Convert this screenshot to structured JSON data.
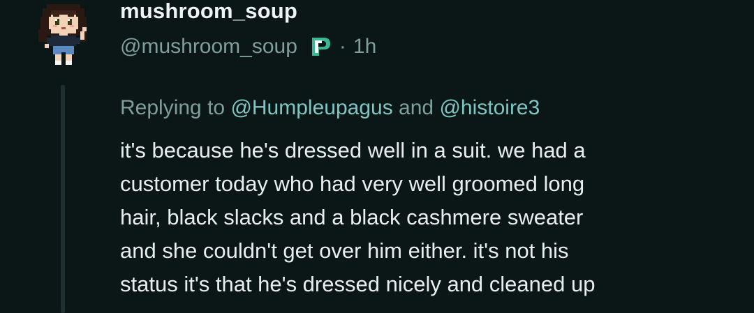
{
  "post": {
    "display_name": "mushroom_soup",
    "handle": "@mushroom_soup",
    "badge_icon": "patreon-p-badge-icon",
    "separator": "·",
    "time": "1h",
    "replying": {
      "prefix": "Replying to",
      "mention_1": "@Humpleupagus",
      "conjunction": "and",
      "mention_2": "@histoire3"
    },
    "body_lines": [
      "it's because he's dressed well in a suit. we had a",
      "customer today who had very well groomed long",
      "hair, black slacks and a black cashmere sweater",
      "and she couldn't get over him either. it's not his",
      "status it's that he's dressed nicely and cleaned up"
    ]
  },
  "colors": {
    "background": "#0b1717",
    "text_primary": "#e8eeee",
    "text_secondary": "#7f9e9c",
    "mention": "#7fc6c2",
    "badge": "#3ab894"
  }
}
